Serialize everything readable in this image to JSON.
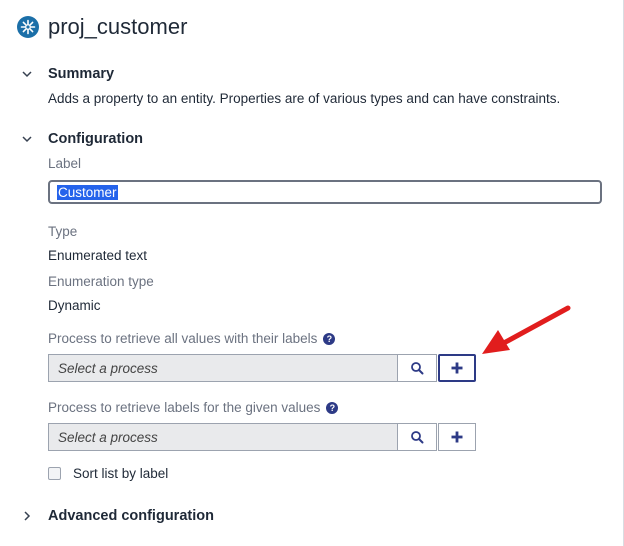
{
  "header": {
    "title": "proj_customer",
    "icon": "asterisk-gear-icon",
    "icon_color": "#1b6fa8"
  },
  "summary": {
    "heading": "Summary",
    "description": "Adds a property to an entity. Properties are of various types and can have constraints."
  },
  "configuration": {
    "heading": "Configuration",
    "label_caption": "Label",
    "label_value": "Customer",
    "type_caption": "Type",
    "type_value": "Enumerated text",
    "enum_caption": "Enumeration type",
    "enum_value": "Dynamic",
    "process_all": {
      "caption": "Process to retrieve all values with their labels",
      "placeholder": "Select a process"
    },
    "process_labels": {
      "caption": "Process to retrieve labels for the given values",
      "placeholder": "Select a process"
    },
    "sort_label": "Sort list by label",
    "sort_checked": false
  },
  "advanced": {
    "heading": "Advanced configuration"
  },
  "colors": {
    "accent": "#2d3a86",
    "selection": "#2563eb",
    "annotation_arrow": "#e11d1d"
  }
}
